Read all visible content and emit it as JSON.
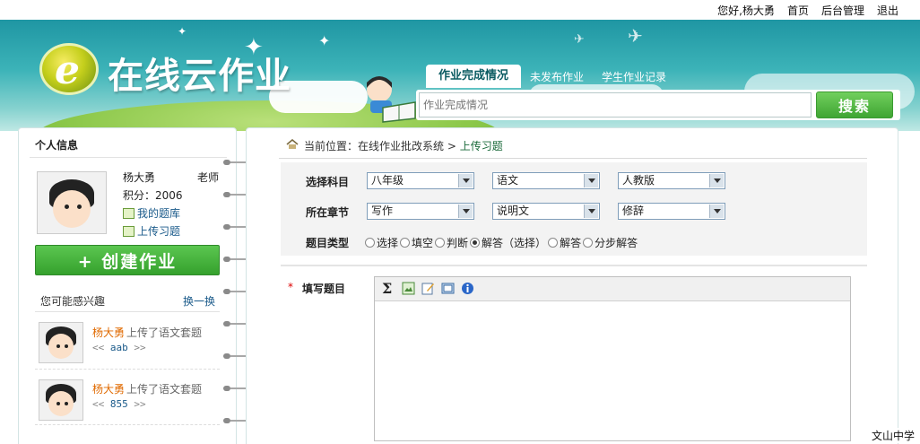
{
  "topbar": {
    "greeting": "您好,杨大勇",
    "home": "首页",
    "admin": "后台管理",
    "logout": "退出"
  },
  "brand": {
    "logo_letter": "e",
    "title": "在线云作业"
  },
  "nav": {
    "tabs": [
      {
        "label": "作业完成情况",
        "active": true
      },
      {
        "label": "未发布作业",
        "active": false
      },
      {
        "label": "学生作业记录",
        "active": false
      }
    ]
  },
  "search": {
    "placeholder": "作业完成情况",
    "button": "搜索"
  },
  "profile": {
    "panel_title": "个人信息",
    "name": "杨大勇",
    "role": "老师",
    "score": "积分：2006",
    "my_bank": "我的题库",
    "upload": "上传习题",
    "create_button": "+ 创建作业"
  },
  "interests": {
    "title": "您可能感兴趣",
    "switch": "换一换",
    "items": [
      {
        "author": "杨大勇",
        "action": "上传了语文套题",
        "code": "aab"
      },
      {
        "author": "杨大勇",
        "action": "上传了语文套题",
        "code": "855"
      }
    ]
  },
  "breadcrumb": {
    "prefix": "当前位置：在线作业批改系统 >",
    "current": "上传习题"
  },
  "form": {
    "subject_label": "选择科目",
    "subject_values": [
      "八年级",
      "语文",
      "人教版"
    ],
    "chapter_label": "所在章节",
    "chapter_values": [
      "写作",
      "说明文",
      "修辞"
    ],
    "type_label": "题目类型",
    "types": [
      {
        "label": "选择",
        "checked": false
      },
      {
        "label": "填空",
        "checked": false
      },
      {
        "label": "判断",
        "checked": false
      },
      {
        "label": "解答（选择）",
        "checked": true
      },
      {
        "label": "解答",
        "checked": false
      },
      {
        "label": "分步解答",
        "checked": false
      }
    ],
    "required_mark": "*",
    "fill_label": "填写题目",
    "toolbar_sigma": "Σ"
  },
  "footer": {
    "school": "文山中学"
  },
  "colors": {
    "banner": "#2aa5ae",
    "accent_green": "#3fa533",
    "link_blue": "#1a5a8a",
    "author_orange": "#e06a00"
  }
}
